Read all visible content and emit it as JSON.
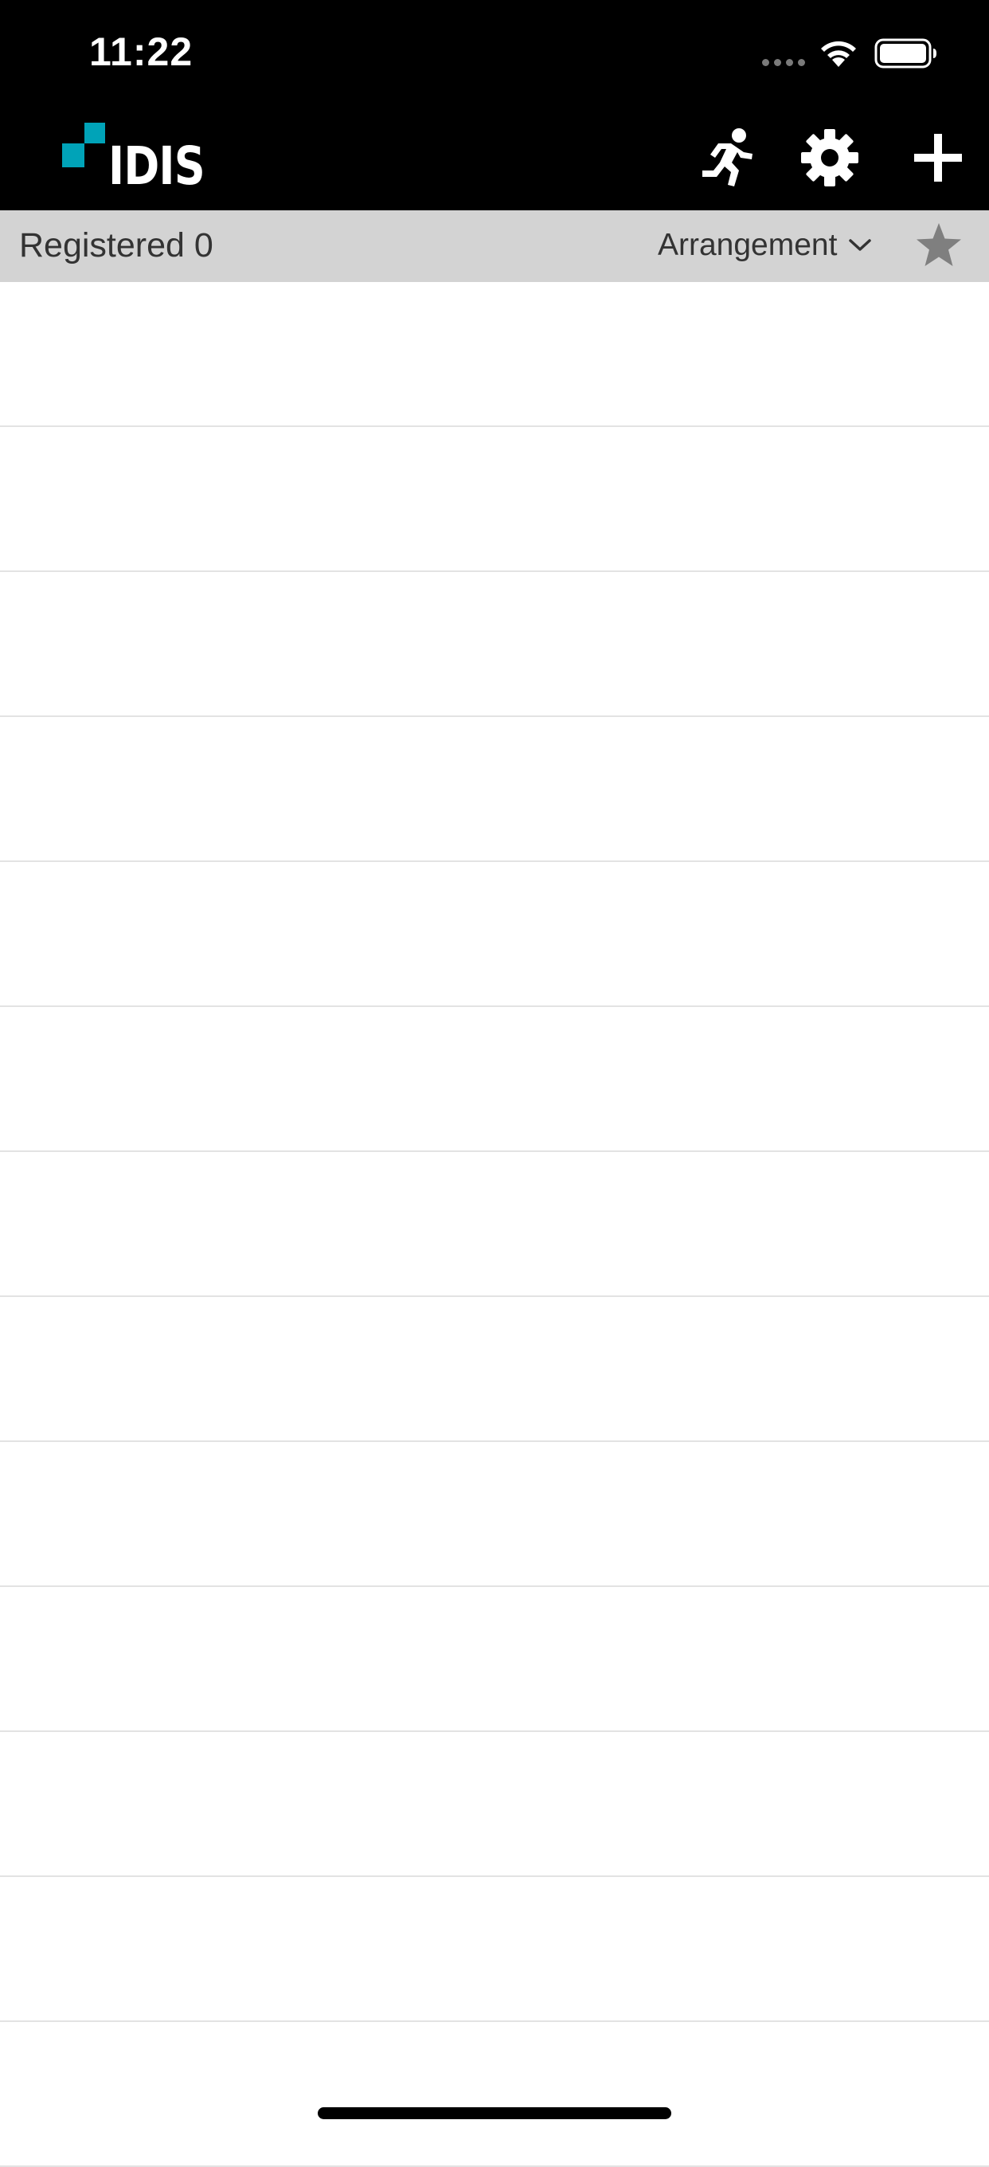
{
  "status_bar": {
    "time": "11:22",
    "wifi_icon": "wifi-icon",
    "battery_icon": "battery-icon"
  },
  "header": {
    "logo_text": "IDIS",
    "brand_color": "#00a3b8",
    "actions": [
      {
        "icon": "running-person-icon"
      },
      {
        "icon": "gear-icon"
      },
      {
        "icon": "plus-icon"
      }
    ]
  },
  "toolbar": {
    "registered_label": "Registered 0",
    "arrangement_label": "Arrangement",
    "arrangement_icon": "chevron-down-icon",
    "favorite_icon": "star-icon"
  },
  "device_list": {
    "items": []
  },
  "colors": {
    "header_bg": "#000000",
    "toolbar_bg": "#d3d3d3",
    "separator": "#e3e3e3",
    "icon_gray": "#7f7f7f"
  }
}
